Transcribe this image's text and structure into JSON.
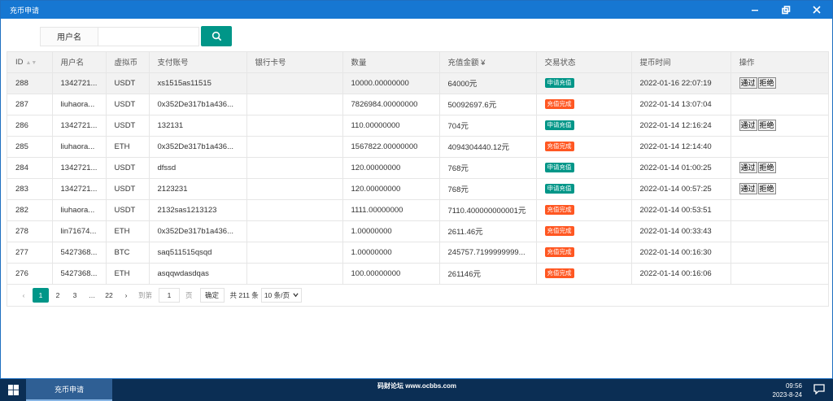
{
  "window": {
    "title": "充币申请"
  },
  "search": {
    "label": "用户名",
    "value": "",
    "placeholder": ""
  },
  "table": {
    "columns": [
      "ID",
      "用户名",
      "虚拟币",
      "支付账号",
      "银行卡号",
      "数量",
      "充值金额 ¥",
      "交易状态",
      "提币时间",
      "操作"
    ],
    "rows": [
      {
        "id": "288",
        "user": "1342721...",
        "coin": "USDT",
        "account": "xs1515as11515",
        "bank": "",
        "qty": "10000.00000000",
        "amount": "64000元",
        "status": "申请充值",
        "time": "2022-01-16 22:07:19",
        "actions": [
          "通过",
          "拒绝"
        ]
      },
      {
        "id": "287",
        "user": "liuhaora...",
        "coin": "USDT",
        "account": "0x352De317b1a436...",
        "bank": "",
        "qty": "7826984.00000000",
        "amount": "50092697.6元",
        "status": "充值完成",
        "time": "2022-01-14 13:07:04",
        "actions": []
      },
      {
        "id": "286",
        "user": "1342721...",
        "coin": "USDT",
        "account": "132131",
        "bank": "",
        "qty": "110.00000000",
        "amount": "704元",
        "status": "申请充值",
        "time": "2022-01-14 12:16:24",
        "actions": [
          "通过",
          "拒绝"
        ]
      },
      {
        "id": "285",
        "user": "liuhaora...",
        "coin": "ETH",
        "account": "0x352De317b1a436...",
        "bank": "",
        "qty": "1567822.00000000",
        "amount": "4094304440.12元",
        "status": "充值完成",
        "time": "2022-01-14 12:14:40",
        "actions": []
      },
      {
        "id": "284",
        "user": "1342721...",
        "coin": "USDT",
        "account": "dfssd",
        "bank": "",
        "qty": "120.00000000",
        "amount": "768元",
        "status": "申请充值",
        "time": "2022-01-14 01:00:25",
        "actions": [
          "通过",
          "拒绝"
        ]
      },
      {
        "id": "283",
        "user": "1342721...",
        "coin": "USDT",
        "account": "2123231",
        "bank": "",
        "qty": "120.00000000",
        "amount": "768元",
        "status": "申请充值",
        "time": "2022-01-14 00:57:25",
        "actions": [
          "通过",
          "拒绝"
        ]
      },
      {
        "id": "282",
        "user": "liuhaora...",
        "coin": "USDT",
        "account": "2132sas1213123",
        "bank": "",
        "qty": "1111.00000000",
        "amount": "7110.400000000001元",
        "status": "充值完成",
        "time": "2022-01-14 00:53:51",
        "actions": []
      },
      {
        "id": "278",
        "user": "lin71674...",
        "coin": "ETH",
        "account": "0x352De317b1a436...",
        "bank": "",
        "qty": "1.00000000",
        "amount": "2611.46元",
        "status": "充值完成",
        "time": "2022-01-14 00:33:43",
        "actions": []
      },
      {
        "id": "277",
        "user": "5427368...",
        "coin": "BTC",
        "account": "saq511515qsqd",
        "bank": "",
        "qty": "1.00000000",
        "amount": "245757.7199999999...",
        "status": "充值完成",
        "time": "2022-01-14 00:16:30",
        "actions": []
      },
      {
        "id": "276",
        "user": "5427368...",
        "coin": "ETH",
        "account": "asqqwdasdqas",
        "bank": "",
        "qty": "100.00000000",
        "amount": "261146元",
        "status": "充值完成",
        "time": "2022-01-14 00:16:06",
        "actions": []
      }
    ]
  },
  "status_colors": {
    "申请充值": "#009688",
    "充值完成": "#ff5722"
  },
  "pager": {
    "prev": "‹",
    "pages": [
      "1",
      "2",
      "3",
      "…",
      "22"
    ],
    "next": "›",
    "goto_label": "到第",
    "goto_value": "1",
    "page_unit": "页",
    "confirm": "确定",
    "total": "共 211 条",
    "per_page": "10 条/页"
  },
  "taskbar": {
    "task_item": "充币申请",
    "watermark": "码财论坛 www.ocbbs.com",
    "time": "09:56",
    "date": "2023-8-24"
  },
  "colors": {
    "titlebar": "#1677d2",
    "accent": "#009688",
    "taskbar": "#0b2e54"
  }
}
